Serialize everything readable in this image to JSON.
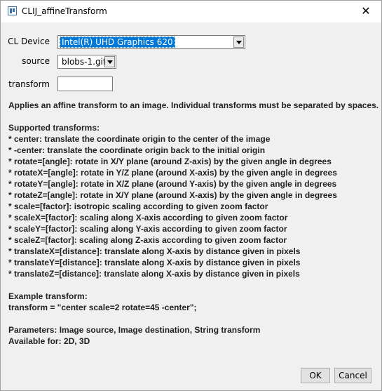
{
  "window": {
    "title": "CLIJ_affineTransform",
    "close_glyph": "✕"
  },
  "form": {
    "device_label": "CL Device",
    "device_value": "Intel(R) UHD Graphics 620",
    "source_label": "source",
    "source_value": "blobs-1.gif",
    "transform_label": "transform",
    "transform_value": ""
  },
  "help": {
    "intro": "Applies an affine transform to an image. Individual transforms must be separated by spaces.",
    "supported_heading": "Supported transforms:",
    "transforms": [
      "* center: translate the coordinate origin to the center of the image",
      "* -center: translate the coordinate origin back to the initial origin",
      "* rotate=[angle]: rotate in X/Y plane (around Z-axis) by the given angle in degrees",
      "* rotateX=[angle]: rotate in Y/Z plane (around X-axis) by the given angle in degrees",
      "* rotateY=[angle]: rotate in X/Z plane (around Y-axis) by the given angle in degrees",
      "* rotateZ=[angle]: rotate in X/Y plane (around X-axis) by the given angle in degrees",
      "* scale=[factor]: isotropic scaling according to given zoom factor",
      "* scaleX=[factor]: scaling along X-axis according to given zoom factor",
      "* scaleY=[factor]: scaling along Y-axis according to given zoom factor",
      "* scaleZ=[factor]: scaling along Z-axis according to given zoom factor",
      "* translateX=[distance]: translate along X-axis by distance given in pixels",
      "* translateY=[distance]: translate along X-axis by distance given in pixels",
      "* translateZ=[distance]: translate along X-axis by distance given in pixels"
    ],
    "example_heading": "Example transform:",
    "example_value": "transform = \"center scale=2 rotate=45 -center\";",
    "parameters": "Parameters: Image source, Image destination, String transform",
    "available": "Available for: 2D, 3D"
  },
  "buttons": {
    "ok_label": "OK",
    "cancel_label": "Cancel"
  }
}
